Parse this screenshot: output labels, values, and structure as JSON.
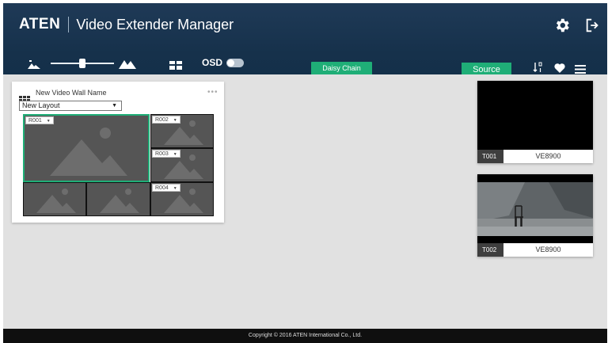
{
  "header": {
    "brand": "ATEN",
    "title": "Video Extender Manager"
  },
  "toolbar": {
    "osd_label": "OSD",
    "osd_enabled": false,
    "zoom_level_fraction": 0.5,
    "daisy_chain_label": "Daisy Chain",
    "source_tab_label": "Source"
  },
  "video_wall": {
    "name": "New Video Wall Name",
    "more_label": "•••",
    "layout_selected": "New Layout",
    "receivers": [
      {
        "id": "R001",
        "selected": true
      },
      {
        "id": "R002",
        "selected": false
      },
      {
        "id": "R003",
        "selected": false
      },
      {
        "id": "R004",
        "selected": false
      }
    ]
  },
  "sources": [
    {
      "id": "T001",
      "model": "VE8900"
    },
    {
      "id": "T002",
      "model": "VE8900"
    }
  ],
  "footer": {
    "copyright": "Copyright © 2016 ATEN International Co., Ltd."
  },
  "colors": {
    "accent": "#1fae77",
    "header": "#1a3551",
    "workspace": "#e1e1e1"
  }
}
